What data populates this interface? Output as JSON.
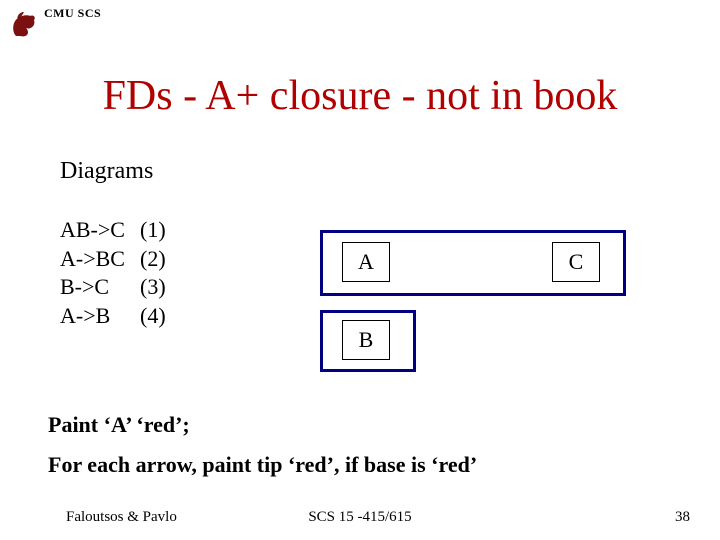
{
  "header": {
    "org": "CMU SCS"
  },
  "title": "FDs - A+ closure - not in book",
  "section_label": "Diagrams",
  "fds": [
    {
      "lhs": "AB->C",
      "num": "(1)"
    },
    {
      "lhs": "A->BC",
      "num": "(2)"
    },
    {
      "lhs": "B->C",
      "num": "(3)"
    },
    {
      "lhs": "A->B",
      "num": "(4)"
    }
  ],
  "nodes": {
    "a": "A",
    "b": "B",
    "c": "C"
  },
  "instruction1": "Paint ‘A’ ‘red’;",
  "instruction2": "For each arrow, paint tip ‘red’, if base is ‘red’",
  "footer": {
    "left": "Faloutsos & Pavlo",
    "center": "SCS 15 -415/615",
    "right": "38"
  }
}
